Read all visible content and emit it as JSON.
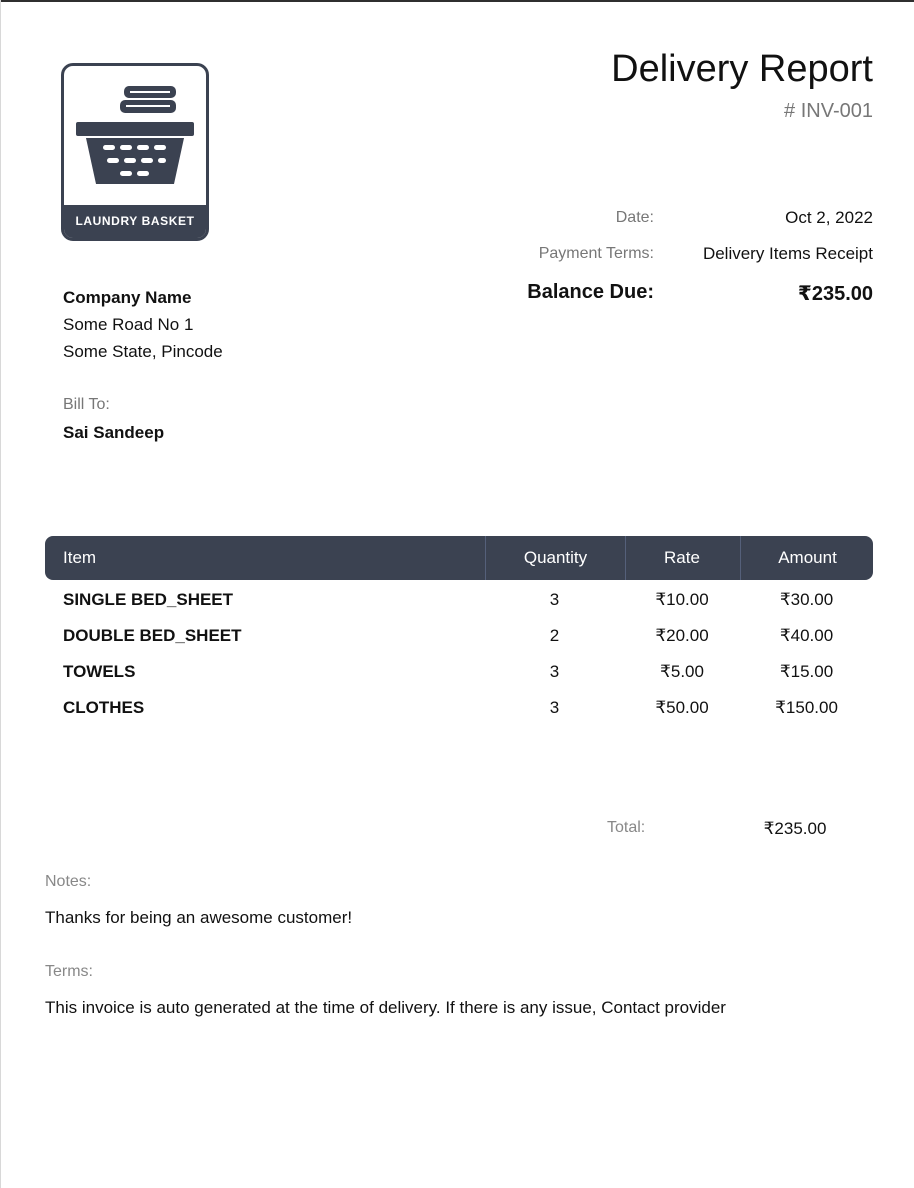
{
  "logo": {
    "label": "LAUNDRY BASKET"
  },
  "header": {
    "title": "Delivery Report",
    "number": "# INV-001"
  },
  "meta": {
    "date_label": "Date:",
    "date_value": "Oct 2, 2022",
    "terms_label": "Payment Terms:",
    "terms_value": "Delivery Items Receipt",
    "balance_label": "Balance Due:",
    "balance_value": "₹235.00"
  },
  "company": {
    "name": "Company Name",
    "line1": "Some Road No 1",
    "line2": "Some State, Pincode"
  },
  "bill_to": {
    "label": "Bill To:",
    "name": "Sai Sandeep"
  },
  "table": {
    "headers": {
      "item": "Item",
      "quantity": "Quantity",
      "rate": "Rate",
      "amount": "Amount"
    },
    "rows": [
      {
        "item": "SINGLE BED_SHEET",
        "quantity": "3",
        "rate": "₹10.00",
        "amount": "₹30.00"
      },
      {
        "item": "DOUBLE BED_SHEET",
        "quantity": "2",
        "rate": "₹20.00",
        "amount": "₹40.00"
      },
      {
        "item": "TOWELS",
        "quantity": "3",
        "rate": "₹5.00",
        "amount": "₹15.00"
      },
      {
        "item": "CLOTHES",
        "quantity": "3",
        "rate": "₹50.00",
        "amount": "₹150.00"
      }
    ]
  },
  "totals": {
    "label": "Total:",
    "value": "₹235.00"
  },
  "notes": {
    "label": "Notes:",
    "text": "Thanks for being an awesome customer!"
  },
  "terms": {
    "label": "Terms:",
    "text": "This invoice is auto generated at the time of delivery. If there is any issue, Contact provider"
  }
}
